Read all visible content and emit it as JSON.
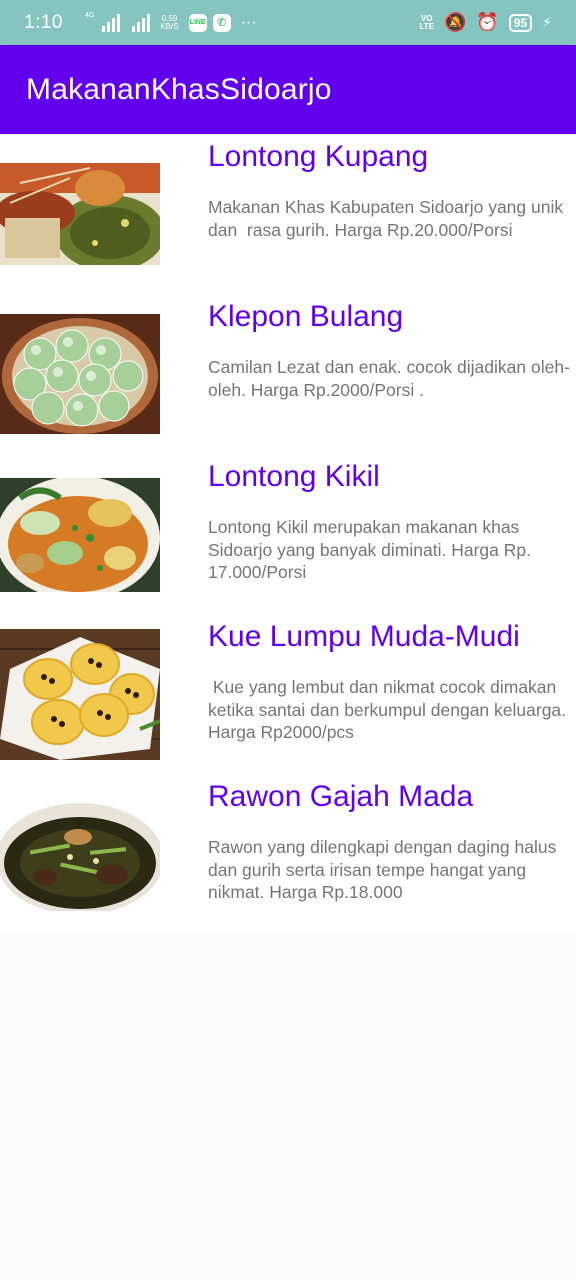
{
  "status_bar": {
    "time": "1:10",
    "net_tag": "4G",
    "speed_value": "0.59",
    "speed_unit": "KB/S",
    "line_label": "LINE",
    "whatsapp_glyph": "✆",
    "more": "···",
    "volte_top": "VO",
    "volte_bottom": "LTE",
    "mute_glyph": "🔕",
    "alarm_glyph": "⏰",
    "battery": "95",
    "bolt": "⚡"
  },
  "app_bar": {
    "title": "MakananKhasSidoarjo",
    "color": "#6200ee"
  },
  "items": [
    {
      "title": "Lontong Kupang",
      "desc": "Makanan Khas Kabupaten Sidoarjo yang unik dan  rasa gurih. Harga Rp.20.000/Porsi",
      "image": "lontong-kupang-photo"
    },
    {
      "title": "Klepon Bulang",
      "desc": "Camilan Lezat dan enak. cocok dijadikan oleh-oleh. Harga Rp.2000/Porsi .",
      "image": "klepon-bulang-photo"
    },
    {
      "title": "Lontong Kikil",
      "desc": "Lontong Kikil merupakan makanan khas Sidoarjo yang banyak diminati. Harga Rp. 17.000/Porsi",
      "image": "lontong-kikil-photo"
    },
    {
      "title": "Kue Lumpu Muda-Mudi",
      "desc": " Kue yang lembut dan nikmat cocok dimakan ketika santai dan berkumpul dengan keluarga. Harga Rp2000/pcs",
      "image": "kue-lumpur-photo"
    },
    {
      "title": "Rawon Gajah Mada",
      "desc": "Rawon yang dilengkapi dengan daging halus dan gurih serta irisan tempe hangat yang nikmat. Harga Rp.18.000",
      "image": "rawon-photo"
    }
  ]
}
